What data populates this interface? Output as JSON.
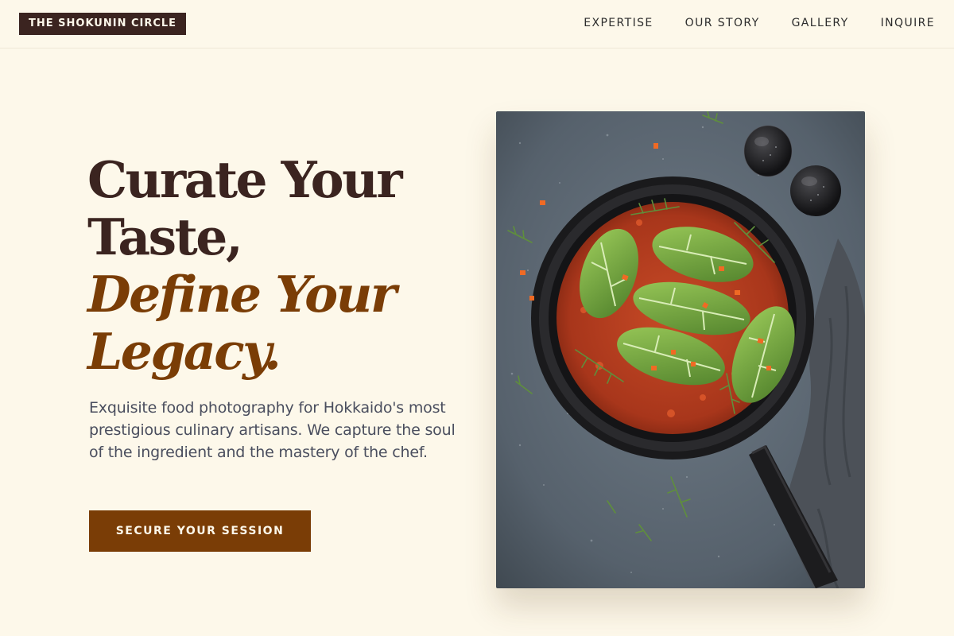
{
  "header": {
    "logo": "THE SHOKUNIN CIRCLE",
    "nav": [
      {
        "label": "EXPERTISE"
      },
      {
        "label": "OUR STORY"
      },
      {
        "label": "GALLERY"
      },
      {
        "label": "INQUIRE"
      }
    ]
  },
  "hero": {
    "headline_line1": "Curate Your",
    "headline_line2": "Taste,",
    "headline_accent_line1": "Define Your",
    "headline_accent_line2": "Legacy.",
    "description": "Exquisite food photography for Hokkaido's most prestigious culinary artisans. We capture the soul of the ingredient and the mastery of the chef.",
    "cta_label": "SECURE YOUR SESSION"
  },
  "colors": {
    "background": "#fdf8ea",
    "dark_brown": "#3b2420",
    "accent_brown": "#7a3d06",
    "body_text": "#4a4e5e"
  }
}
